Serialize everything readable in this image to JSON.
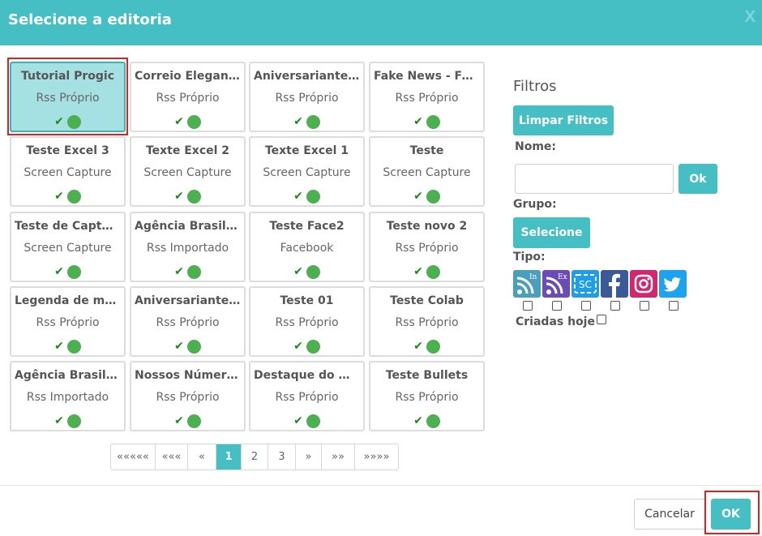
{
  "dialog": {
    "title": "Selecione a editoria",
    "close_label": "X"
  },
  "cards": [
    {
      "title": "Tutorial Progic",
      "subtitle": "Rss Próprio",
      "selected": true
    },
    {
      "title": "Correio Elegante",
      "subtitle": "Rss Próprio",
      "selected": false
    },
    {
      "title": "Aniversariantes do Mês",
      "subtitle": "Rss Próprio",
      "selected": false
    },
    {
      "title": "Fake News - Fevereiro",
      "subtitle": "Rss Próprio",
      "selected": false
    },
    {
      "title": "Teste Excel 3",
      "subtitle": "Screen Capture",
      "selected": false
    },
    {
      "title": "Texte Excel 2",
      "subtitle": "Screen Capture",
      "selected": false
    },
    {
      "title": "Texte Excel 1",
      "subtitle": "Screen Capture",
      "selected": false
    },
    {
      "title": "Teste",
      "subtitle": "Screen Capture",
      "selected": false
    },
    {
      "title": "Teste de Captura",
      "subtitle": "Screen Capture",
      "selected": false
    },
    {
      "title": "Agência Brasil - Notícias",
      "subtitle": "Rss Importado",
      "selected": false
    },
    {
      "title": "Teste Face2",
      "subtitle": "Facebook",
      "selected": false
    },
    {
      "title": "Teste novo 2",
      "subtitle": "Rss Próprio",
      "selected": false
    },
    {
      "title": "Legenda de molduras",
      "subtitle": "Rss Próprio",
      "selected": false
    },
    {
      "title": "Aniversariantes da semana",
      "subtitle": "Rss Próprio",
      "selected": false
    },
    {
      "title": "Teste 01",
      "subtitle": "Rss Próprio",
      "selected": false
    },
    {
      "title": "Teste Colab",
      "subtitle": "Rss Próprio",
      "selected": false
    },
    {
      "title": "Agência Brasil - Economia",
      "subtitle": "Rss Importado",
      "selected": false
    },
    {
      "title": "Nossos Números",
      "subtitle": "Rss Próprio",
      "selected": false
    },
    {
      "title": "Destaque do Mês",
      "subtitle": "Rss Próprio",
      "selected": false
    },
    {
      "title": "Teste Bullets",
      "subtitle": "Rss Próprio",
      "selected": false
    }
  ],
  "pagination": {
    "first": "«««««",
    "prev_many": "«««",
    "prev": "«",
    "pages": [
      "1",
      "2",
      "3"
    ],
    "current": "1",
    "next": "»",
    "next_many": "»»",
    "last": "»»»»"
  },
  "filters": {
    "title": "Filtros",
    "clear_label": "Limpar Filtros",
    "name_label": "Nome:",
    "name_value": "",
    "ok_label": "Ok",
    "group_label": "Grupo:",
    "group_button": "Selecione",
    "type_label": "Tipo:",
    "types": [
      {
        "icon": "rss-in-icon",
        "badge": "In",
        "color": "#4a9fbf"
      },
      {
        "icon": "rss-ex-icon",
        "badge": "Ex",
        "color": "#6a4bb8"
      },
      {
        "icon": "screen-capture-icon",
        "badge": "SC",
        "color": "#1e9ee6"
      },
      {
        "icon": "facebook-icon",
        "badge": "",
        "color": "#3b5998"
      },
      {
        "icon": "instagram-icon",
        "badge": "",
        "color": "#d6246e"
      },
      {
        "icon": "twitter-icon",
        "badge": "",
        "color": "#1da1f2"
      }
    ],
    "created_today_label": "Criadas hoje"
  },
  "footer": {
    "cancel_label": "Cancelar",
    "ok_label": "OK"
  },
  "colors": {
    "accent": "#45bfc4",
    "selected_card": "#a5e0e2",
    "highlight": "#e02020",
    "status_green": "#4caf50"
  }
}
